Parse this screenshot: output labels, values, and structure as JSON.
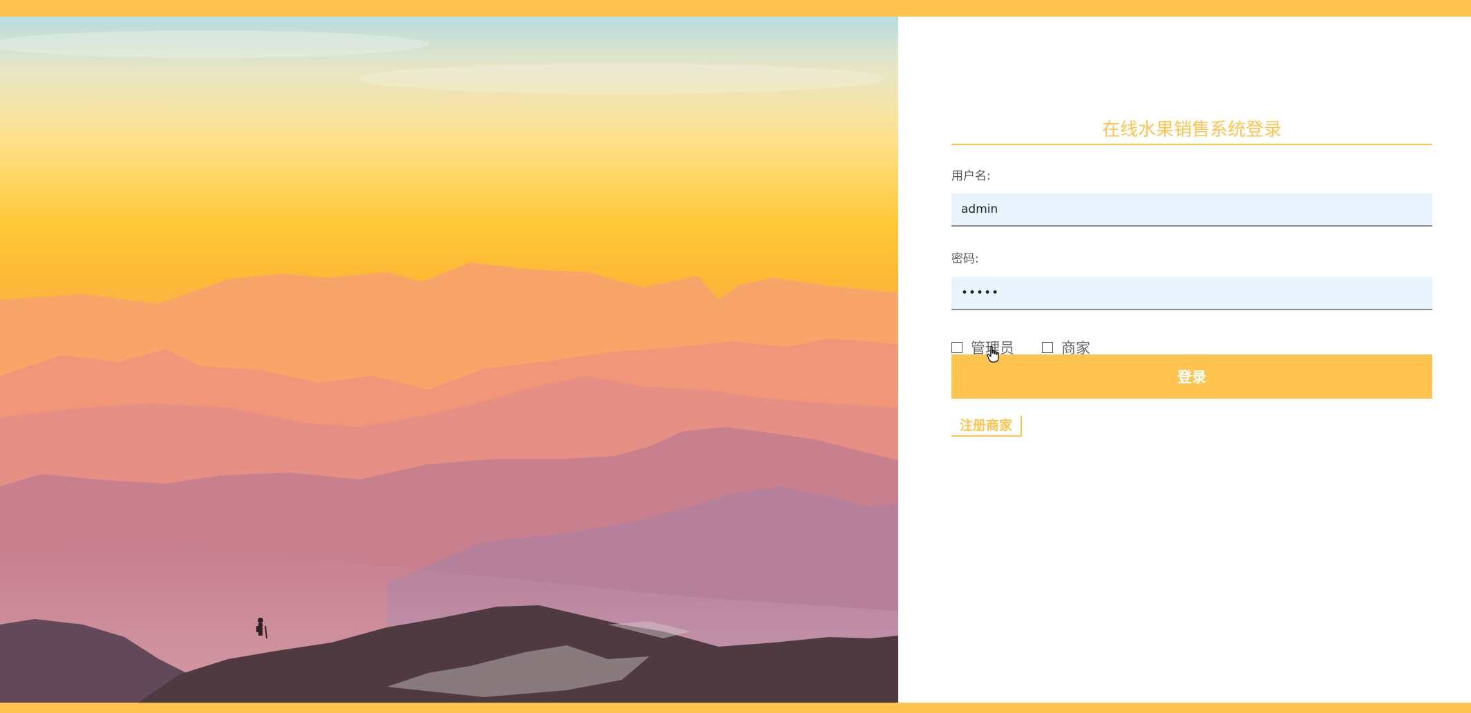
{
  "login": {
    "title": "在线水果销售系统登录",
    "username_label": "用户名:",
    "username_value": "admin",
    "password_label": "密码:",
    "password_value": "•••••",
    "roles": [
      {
        "label": "管理员",
        "checked": false
      },
      {
        "label": "商家",
        "checked": false
      }
    ],
    "login_button": "登录",
    "register_link": "注册商家"
  },
  "colors": {
    "accent": "#FFC44F",
    "input_bg": "#E8F3FE"
  }
}
